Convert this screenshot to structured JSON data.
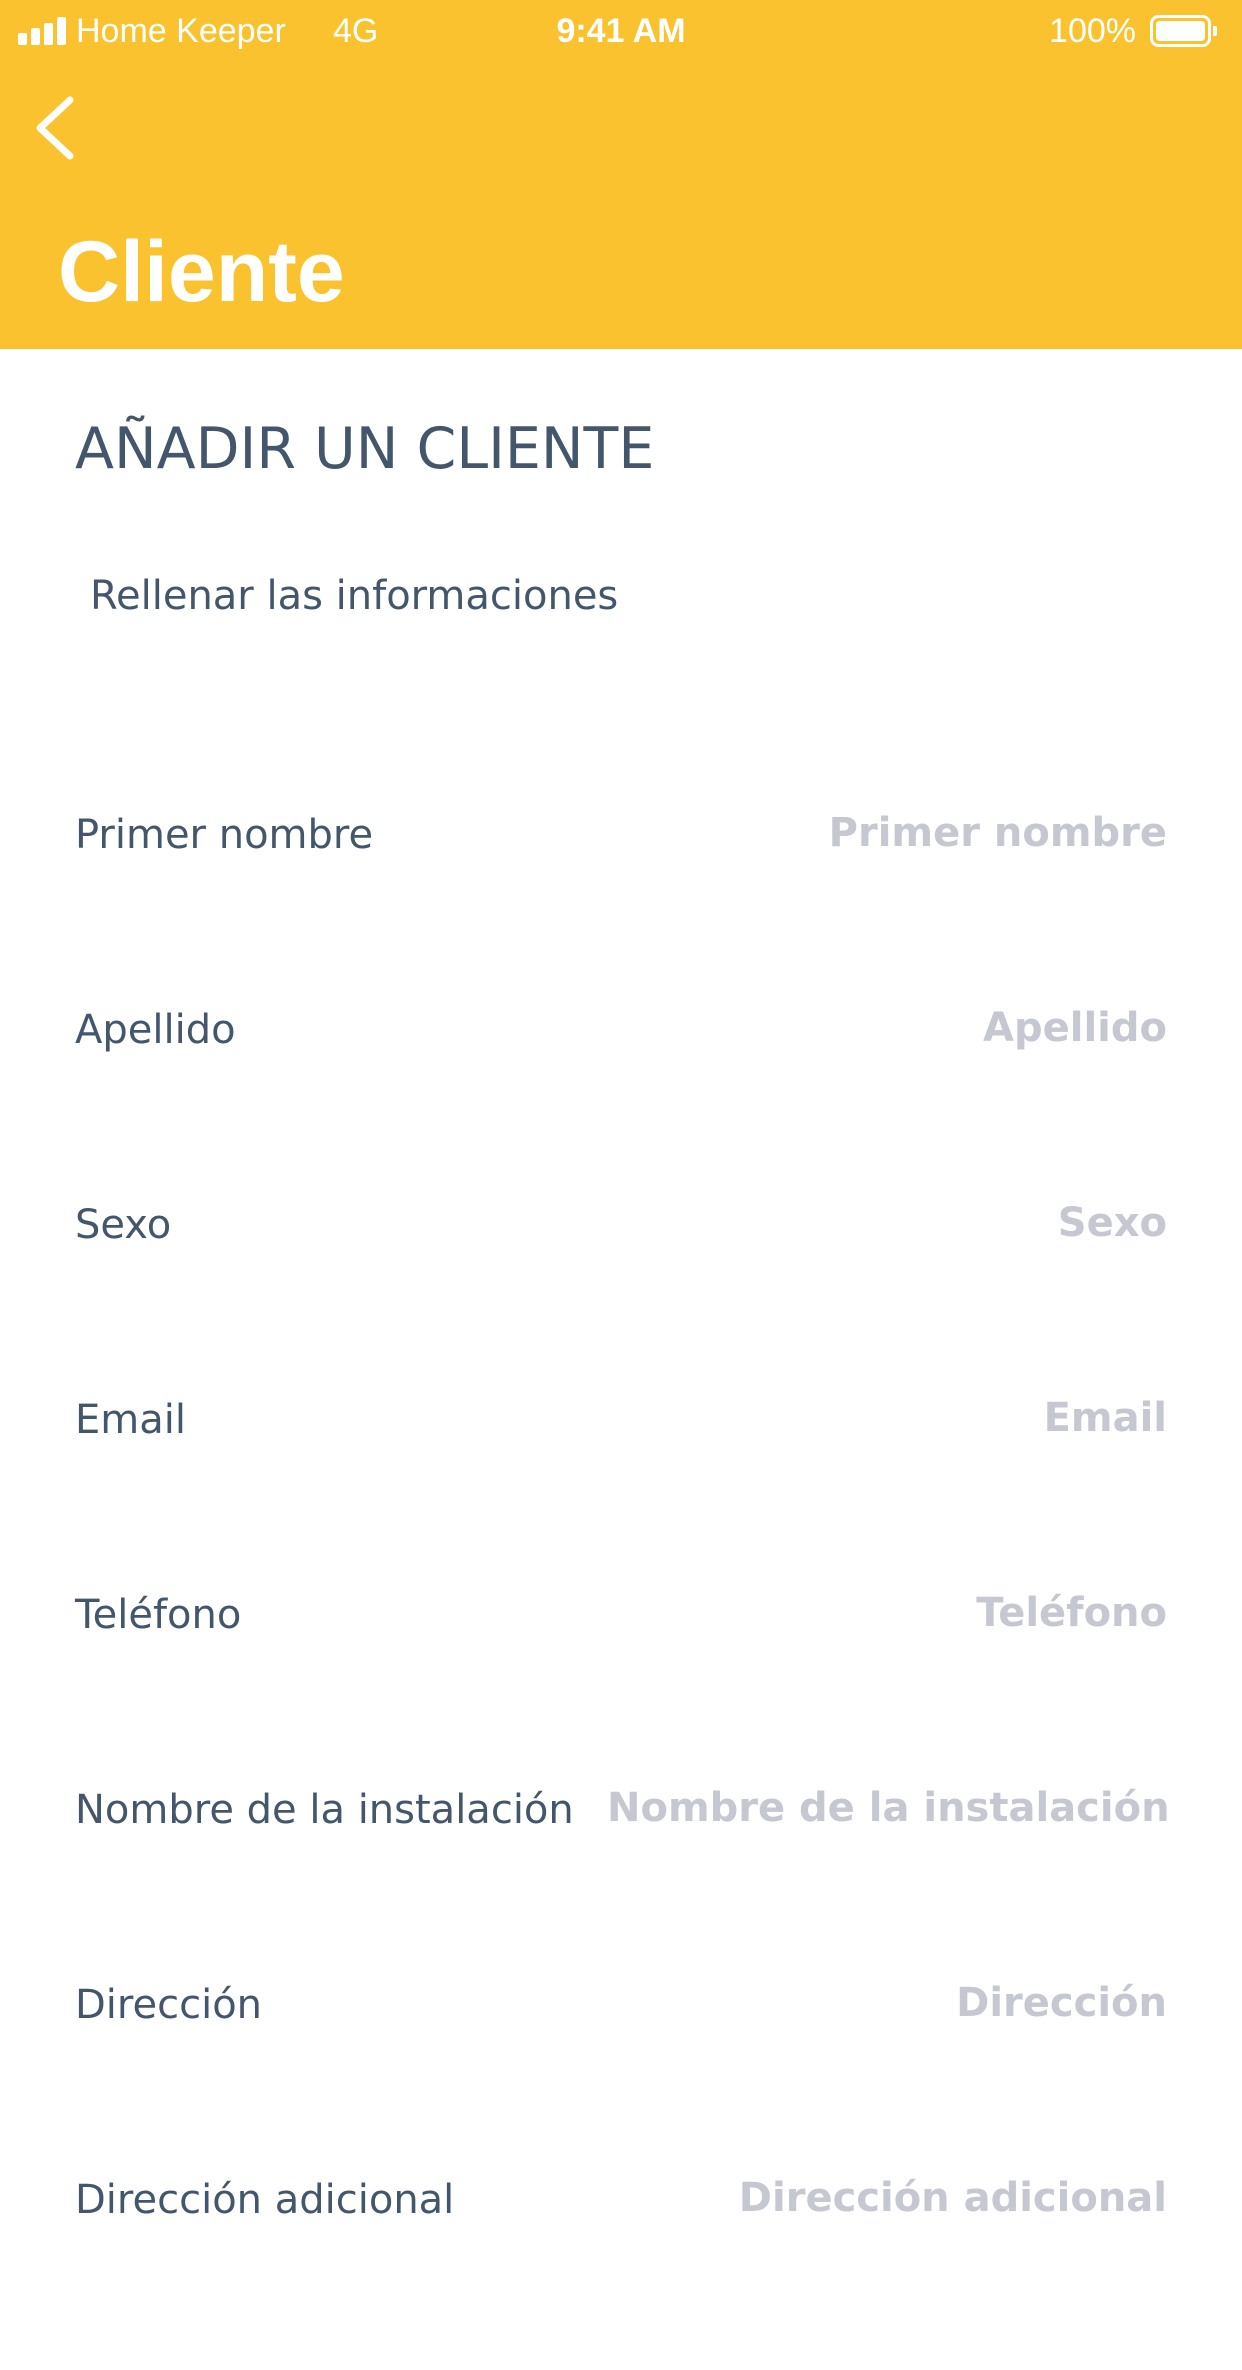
{
  "status_bar": {
    "carrier": "Home Keeper",
    "network": "4G",
    "time": "9:41 AM",
    "battery": "100%"
  },
  "header": {
    "title": "Cliente",
    "background_color": "#f9c22e",
    "back_icon": "chevron-left-icon"
  },
  "main": {
    "title": "AÑADIR UN CLIENTE",
    "subtitle": "Rellenar las informaciones"
  },
  "form": {
    "fields": [
      {
        "label": "Primer nombre",
        "placeholder": "Primer nombre",
        "value": ""
      },
      {
        "label": "Apellido",
        "placeholder": "Apellido",
        "value": ""
      },
      {
        "label": "Sexo",
        "placeholder": "Sexo",
        "value": ""
      },
      {
        "label": "Email",
        "placeholder": "Email",
        "value": ""
      },
      {
        "label": "Teléfono",
        "placeholder": "Teléfono",
        "value": ""
      },
      {
        "label": "Nombre de la instalación",
        "placeholder": "Nombre de la instalación",
        "value": ""
      },
      {
        "label": "Dirección",
        "placeholder": "Dirección",
        "value": ""
      },
      {
        "label": "Dirección adicional",
        "placeholder": "Dirección adicional",
        "value": ""
      }
    ]
  },
  "colors": {
    "accent": "#f9c22e",
    "text": "#44566c",
    "placeholder": "#c5c7d1"
  }
}
